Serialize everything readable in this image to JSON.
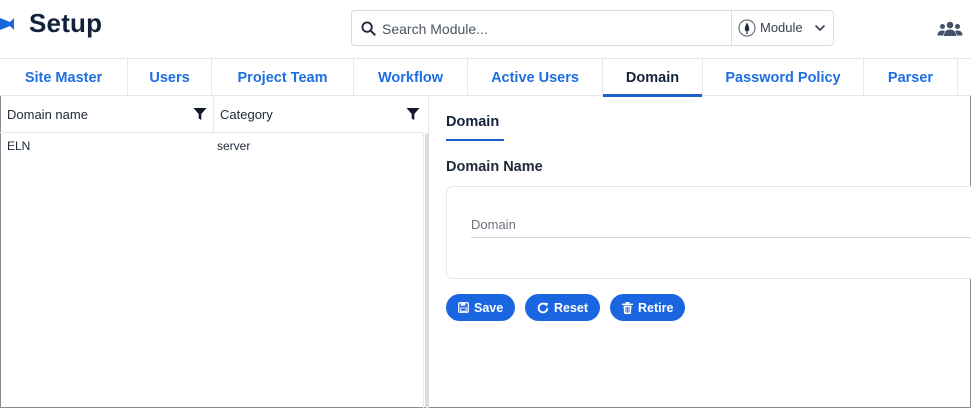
{
  "header": {
    "title": "Setup",
    "search": {
      "placeholder": "Search Module...",
      "value": ""
    },
    "module_select": {
      "label": "Module"
    }
  },
  "tabs": [
    {
      "label": "Site Master"
    },
    {
      "label": "Users"
    },
    {
      "label": "Project Team"
    },
    {
      "label": "Workflow"
    },
    {
      "label": "Active Users"
    },
    {
      "label": "Domain",
      "active": true
    },
    {
      "label": "Password Policy"
    },
    {
      "label": "Parser"
    }
  ],
  "table": {
    "columns": [
      "Domain name",
      "Category"
    ],
    "rows": [
      [
        "ELN",
        "server"
      ]
    ]
  },
  "form": {
    "tab_label": "Domain",
    "section_label": "Domain Name",
    "domain_input": {
      "placeholder": "Domain",
      "value": ""
    },
    "buttons": {
      "save": "Save",
      "reset": "Reset",
      "retire": "Retire"
    }
  },
  "colors": {
    "accent": "#1a66e0",
    "tab_text": "#1e6fe0",
    "title": "#14233c"
  },
  "icons": {
    "logo": "app-logo",
    "search": "search-icon",
    "module": "module-icon",
    "chevron": "chevron-down-icon",
    "users": "users-icon",
    "filter": "filter-icon",
    "save": "save-icon",
    "reset": "reset-icon",
    "retire": "trash-icon"
  }
}
